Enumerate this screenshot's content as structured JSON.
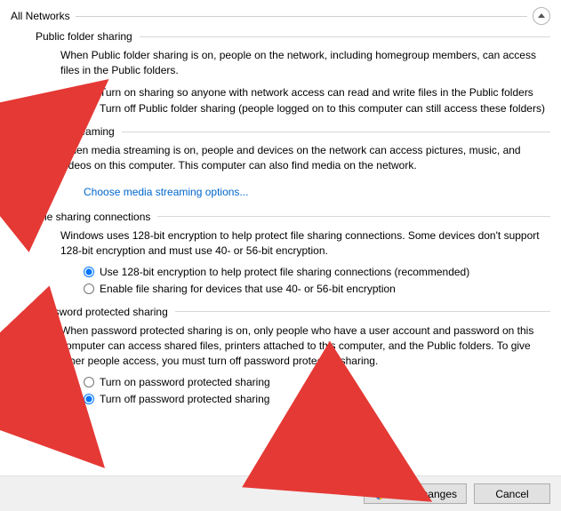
{
  "header": {
    "title": "All Networks"
  },
  "groups": {
    "pfs": {
      "title": "Public folder sharing",
      "desc": "When Public folder sharing is on, people on the network, including homegroup members, can access files in the Public folders.",
      "opt_on": "Turn on sharing so anyone with network access can read and write files in the Public folders",
      "opt_off": "Turn off Public folder sharing (people logged on to this computer can still access these folders)"
    },
    "ms": {
      "title": "Media streaming",
      "desc": "When media streaming is on, people and devices on the network can access pictures, music, and videos on this computer. This computer can also find media on the network.",
      "link": "Choose media streaming options..."
    },
    "fsc": {
      "title": "File sharing connections",
      "desc": "Windows uses 128-bit encryption to help protect file sharing connections. Some devices don't support 128-bit encryption and must use 40- or 56-bit encryption.",
      "opt_128": "Use 128-bit encryption to help protect file sharing connections (recommended)",
      "opt_4056": "Enable file sharing for devices that use 40- or 56-bit encryption"
    },
    "pps": {
      "title": "Password protected sharing",
      "desc": "When password protected sharing is on, only people who have a user account and password on this computer can access shared files, printers attached to this computer, and the Public folders. To give other people access, you must turn off password protected sharing.",
      "opt_on": "Turn on password protected sharing",
      "opt_off": "Turn off password protected sharing"
    }
  },
  "footer": {
    "save": "Save changes",
    "cancel": "Cancel"
  }
}
